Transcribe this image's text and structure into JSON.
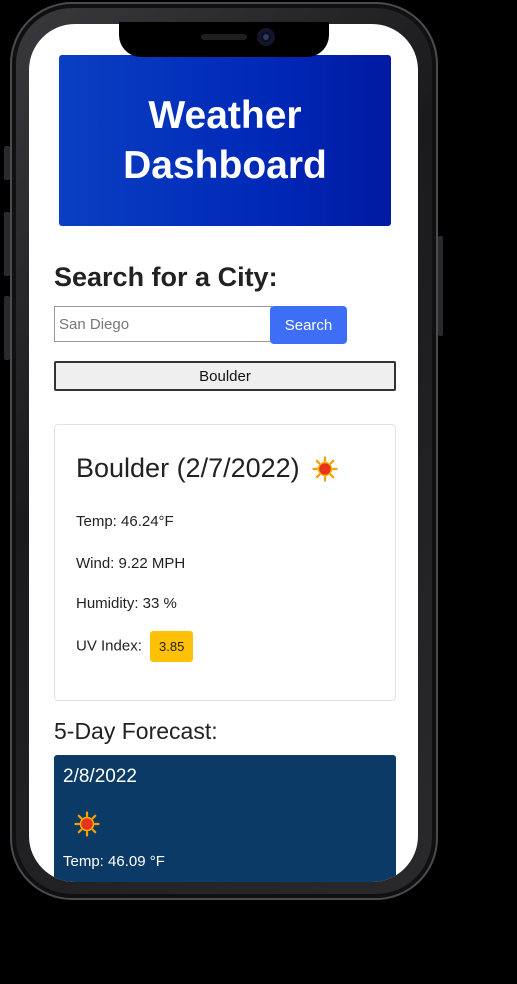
{
  "header": {
    "title_line1": "Weather",
    "title_line2": "Dashboard"
  },
  "search": {
    "heading": "Search for a City:",
    "placeholder": "San Diego",
    "button_label": "Search",
    "history": [
      "Boulder"
    ]
  },
  "current": {
    "title": "Boulder (2/7/2022)",
    "icon": "sun-icon",
    "temp": "Temp: 46.24°F",
    "wind": "Wind: 9.22 MPH",
    "humidity": "Humidity: 33 %",
    "uv_label": "UV Index:",
    "uv_value": "3.85"
  },
  "forecast": {
    "heading": "5-Day Forecast:",
    "days": [
      {
        "date": "2/8/2022",
        "icon": "sun-icon",
        "temp": "Temp: 46.09 °F"
      }
    ]
  },
  "colors": {
    "banner": "#0029b8",
    "search_button": "#3d6ef5",
    "uv_badge": "#ffc107",
    "forecast_card": "#0b3a66"
  }
}
